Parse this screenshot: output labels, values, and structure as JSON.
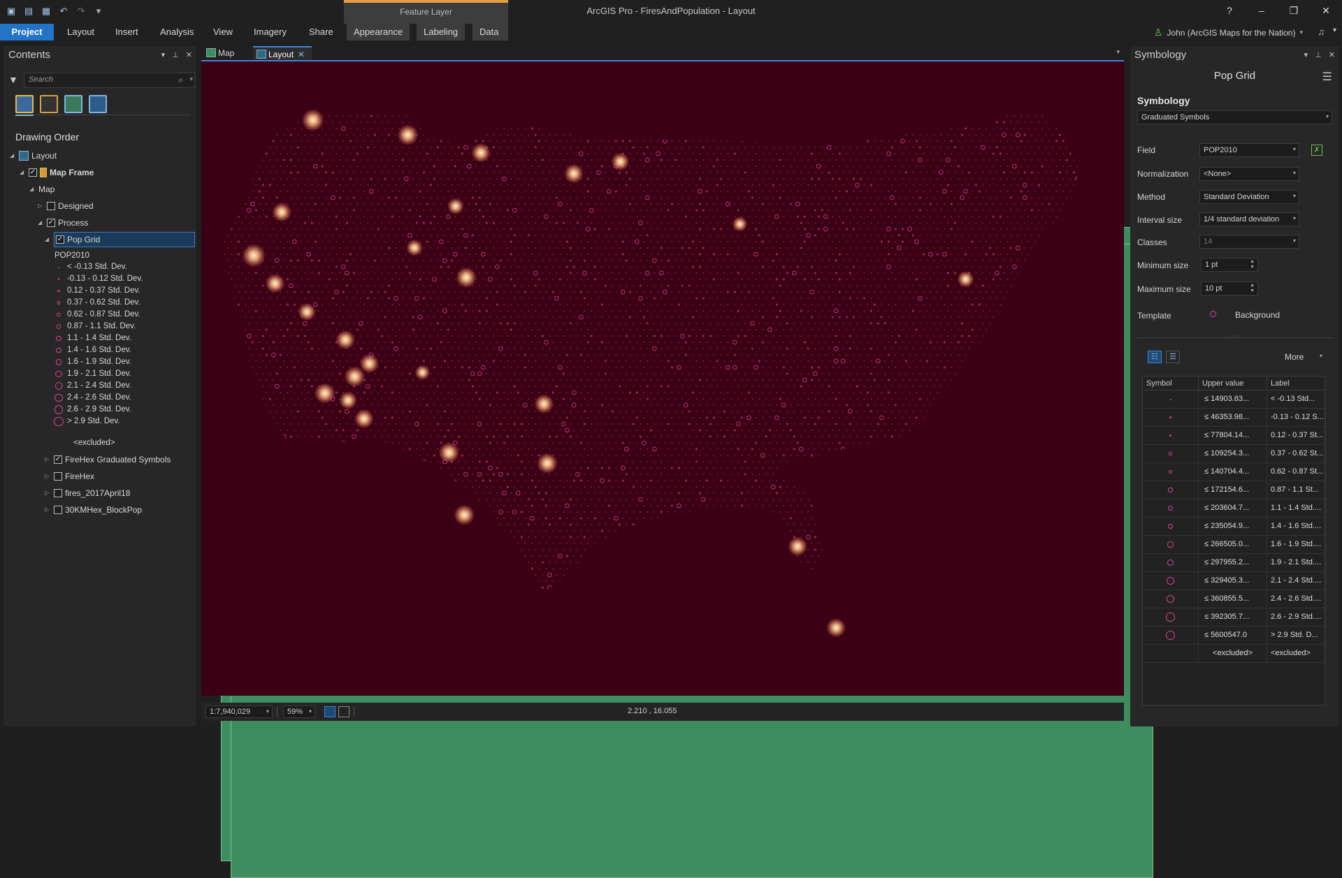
{
  "app": {
    "title": "ArcGIS Pro - FiresAndPopulation - Layout",
    "context_tab_group": "Feature Layer",
    "win_help": "?",
    "win_min": "–",
    "win_max": "❐",
    "win_close": "✕"
  },
  "ribbon": {
    "tabs": [
      "Project",
      "Layout",
      "Insert",
      "Analysis",
      "View",
      "Imagery",
      "Share",
      "Appearance",
      "Labeling",
      "Data"
    ],
    "user": "John (ArcGIS Maps for the Nation)"
  },
  "contents": {
    "title": "Contents",
    "search_placeholder": "Search",
    "drawing_order": "Drawing Order",
    "tree": {
      "layout": "Layout",
      "map_frame": "Map Frame",
      "map": "Map",
      "designed": "Designed",
      "process": "Process",
      "pop_grid": "Pop Grid",
      "field": "POP2010",
      "excluded": "<excluded>",
      "firehex_grad": "FireHex Graduated Symbols",
      "firehex": "FireHex",
      "fires": "fires_2017April18",
      "blockpop": "30KMHex_BlockPop"
    },
    "legend": [
      "< -0.13 Std. Dev.",
      "-0.13 - 0.12 Std. Dev.",
      "0.12 - 0.37 Std. Dev.",
      "0.37 - 0.62 Std. Dev.",
      "0.62 - 0.87 Std. Dev.",
      "0.87 - 1.1 Std. Dev.",
      "1.1 - 1.4 Std. Dev.",
      "1.4 - 1.6 Std. Dev.",
      "1.6 - 1.9 Std. Dev.",
      "1.9 - 2.1 Std. Dev.",
      "2.1 - 2.4 Std. Dev.",
      "2.4 - 2.6 Std. Dev.",
      "2.6 - 2.9 Std. Dev.",
      "> 2.9 Std. Dev."
    ]
  },
  "views": {
    "tabs": [
      "Map",
      "Layout"
    ],
    "status": {
      "scale": "1:7,940,029",
      "zoom": "59%",
      "coords": "2.210 , 16.055"
    }
  },
  "symbology": {
    "title": "Symbology",
    "layer": "Pop Grid",
    "heading": "Symbology",
    "type": "Graduated Symbols",
    "fields": {
      "field_label": "Field",
      "field_value": "POP2010",
      "norm_label": "Normalization",
      "norm_value": "<None>",
      "method_label": "Method",
      "method_value": "Standard Deviation",
      "interval_label": "Interval size",
      "interval_value": "1/4 standard deviation",
      "classes_label": "Classes",
      "classes_value": "14",
      "min_label": "Minimum size",
      "min_value": "1 pt",
      "max_label": "Maximum size",
      "max_value": "10 pt",
      "template_label": "Template",
      "template_value": "Background"
    },
    "more": "More",
    "table": {
      "headers": [
        "Symbol",
        "Upper value",
        "Label"
      ],
      "rows": [
        {
          "upper": "≤  14903.83...",
          "label": "< -0.13 Std..."
        },
        {
          "upper": "≤  46353.98...",
          "label": "-0.13 - 0.12 S..."
        },
        {
          "upper": "≤  77804.14...",
          "label": "0.12 - 0.37 St..."
        },
        {
          "upper": "≤  109254.3...",
          "label": "0.37 - 0.62 St..."
        },
        {
          "upper": "≤  140704.4...",
          "label": "0.62 - 0.87 St..."
        },
        {
          "upper": "≤  172154.6...",
          "label": "0.87 - 1.1 St..."
        },
        {
          "upper": "≤  203604.7...",
          "label": "1.1 - 1.4 Std...."
        },
        {
          "upper": "≤  235054.9...",
          "label": "1.4 - 1.6 Std...."
        },
        {
          "upper": "≤  266505.0...",
          "label": "1.6 - 1.9 Std...."
        },
        {
          "upper": "≤  297955.2...",
          "label": "1.9 - 2.1 Std...."
        },
        {
          "upper": "≤  329405.3...",
          "label": "2.1 - 2.4 Std...."
        },
        {
          "upper": "≤  360855.5...",
          "label": "2.4 - 2.6 Std...."
        },
        {
          "upper": "≤  392305.7...",
          "label": "2.6 - 2.9 Std...."
        },
        {
          "upper": "≤  5600547.0",
          "label": "> 2.9 Std. D..."
        }
      ],
      "excluded_upper": "<excluded>",
      "excluded_label": "<excluded>"
    }
  },
  "colors": {
    "accent": "#2274c7",
    "map_background": "#3c0015",
    "symbol": "#d54694",
    "glow": "#ffd9a0"
  }
}
